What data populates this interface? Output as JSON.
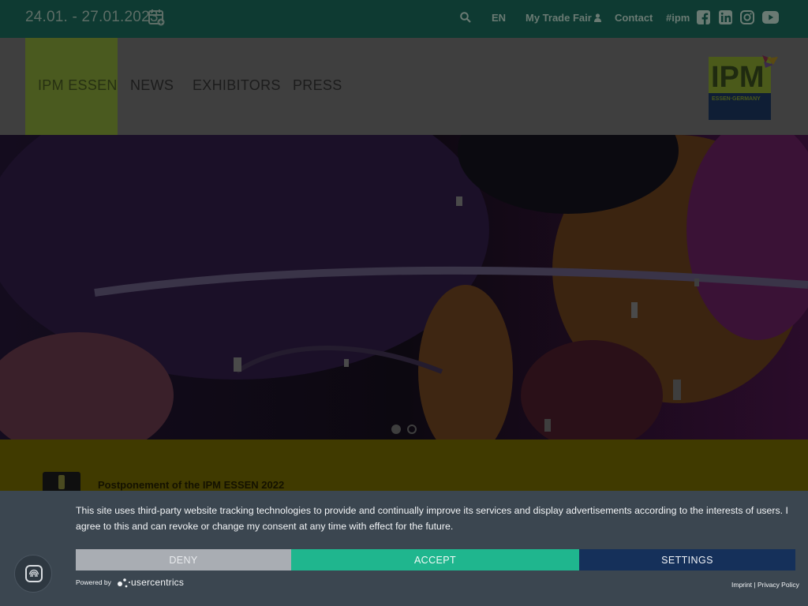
{
  "topbar": {
    "dates": "24.01. - 27.01.2023",
    "language": "EN",
    "my_trade_fair": "My Trade Fair",
    "contact": "Contact",
    "hashtag": "#ipm"
  },
  "header": {
    "menu": [
      "IPM ESSEN",
      "NEWS",
      "EXHIBITORS",
      "PRESS"
    ],
    "active_index": 0,
    "logo": {
      "main": "IPM",
      "sub": "ESSEN·GERMANY"
    }
  },
  "hero": {
    "slide_count": 2,
    "active_slide": 1
  },
  "notice": {
    "title": "Postponement of the IPM ESSEN 2022"
  },
  "cookie_banner": {
    "text": "This site uses third-party website tracking technologies to provide and continually improve its services and display advertisements according to the interests of users. I agree to this and can revoke or change my consent at any time with effect for the future.",
    "deny_label": "DENY",
    "accept_label": "ACCEPT",
    "settings_label": "SETTINGS",
    "powered_by": "Powered by",
    "brand": "usercentrics",
    "imprint": "Imprint",
    "separator": "|",
    "privacy": "Privacy Policy"
  },
  "colors": {
    "topbar_bg": "#0e3a32",
    "active_menu_bg": "#4a5a1f",
    "accept": "#1fb68e",
    "settings": "#15305a",
    "deny": "#a9adb3",
    "banner_bg": "#3b4650"
  }
}
